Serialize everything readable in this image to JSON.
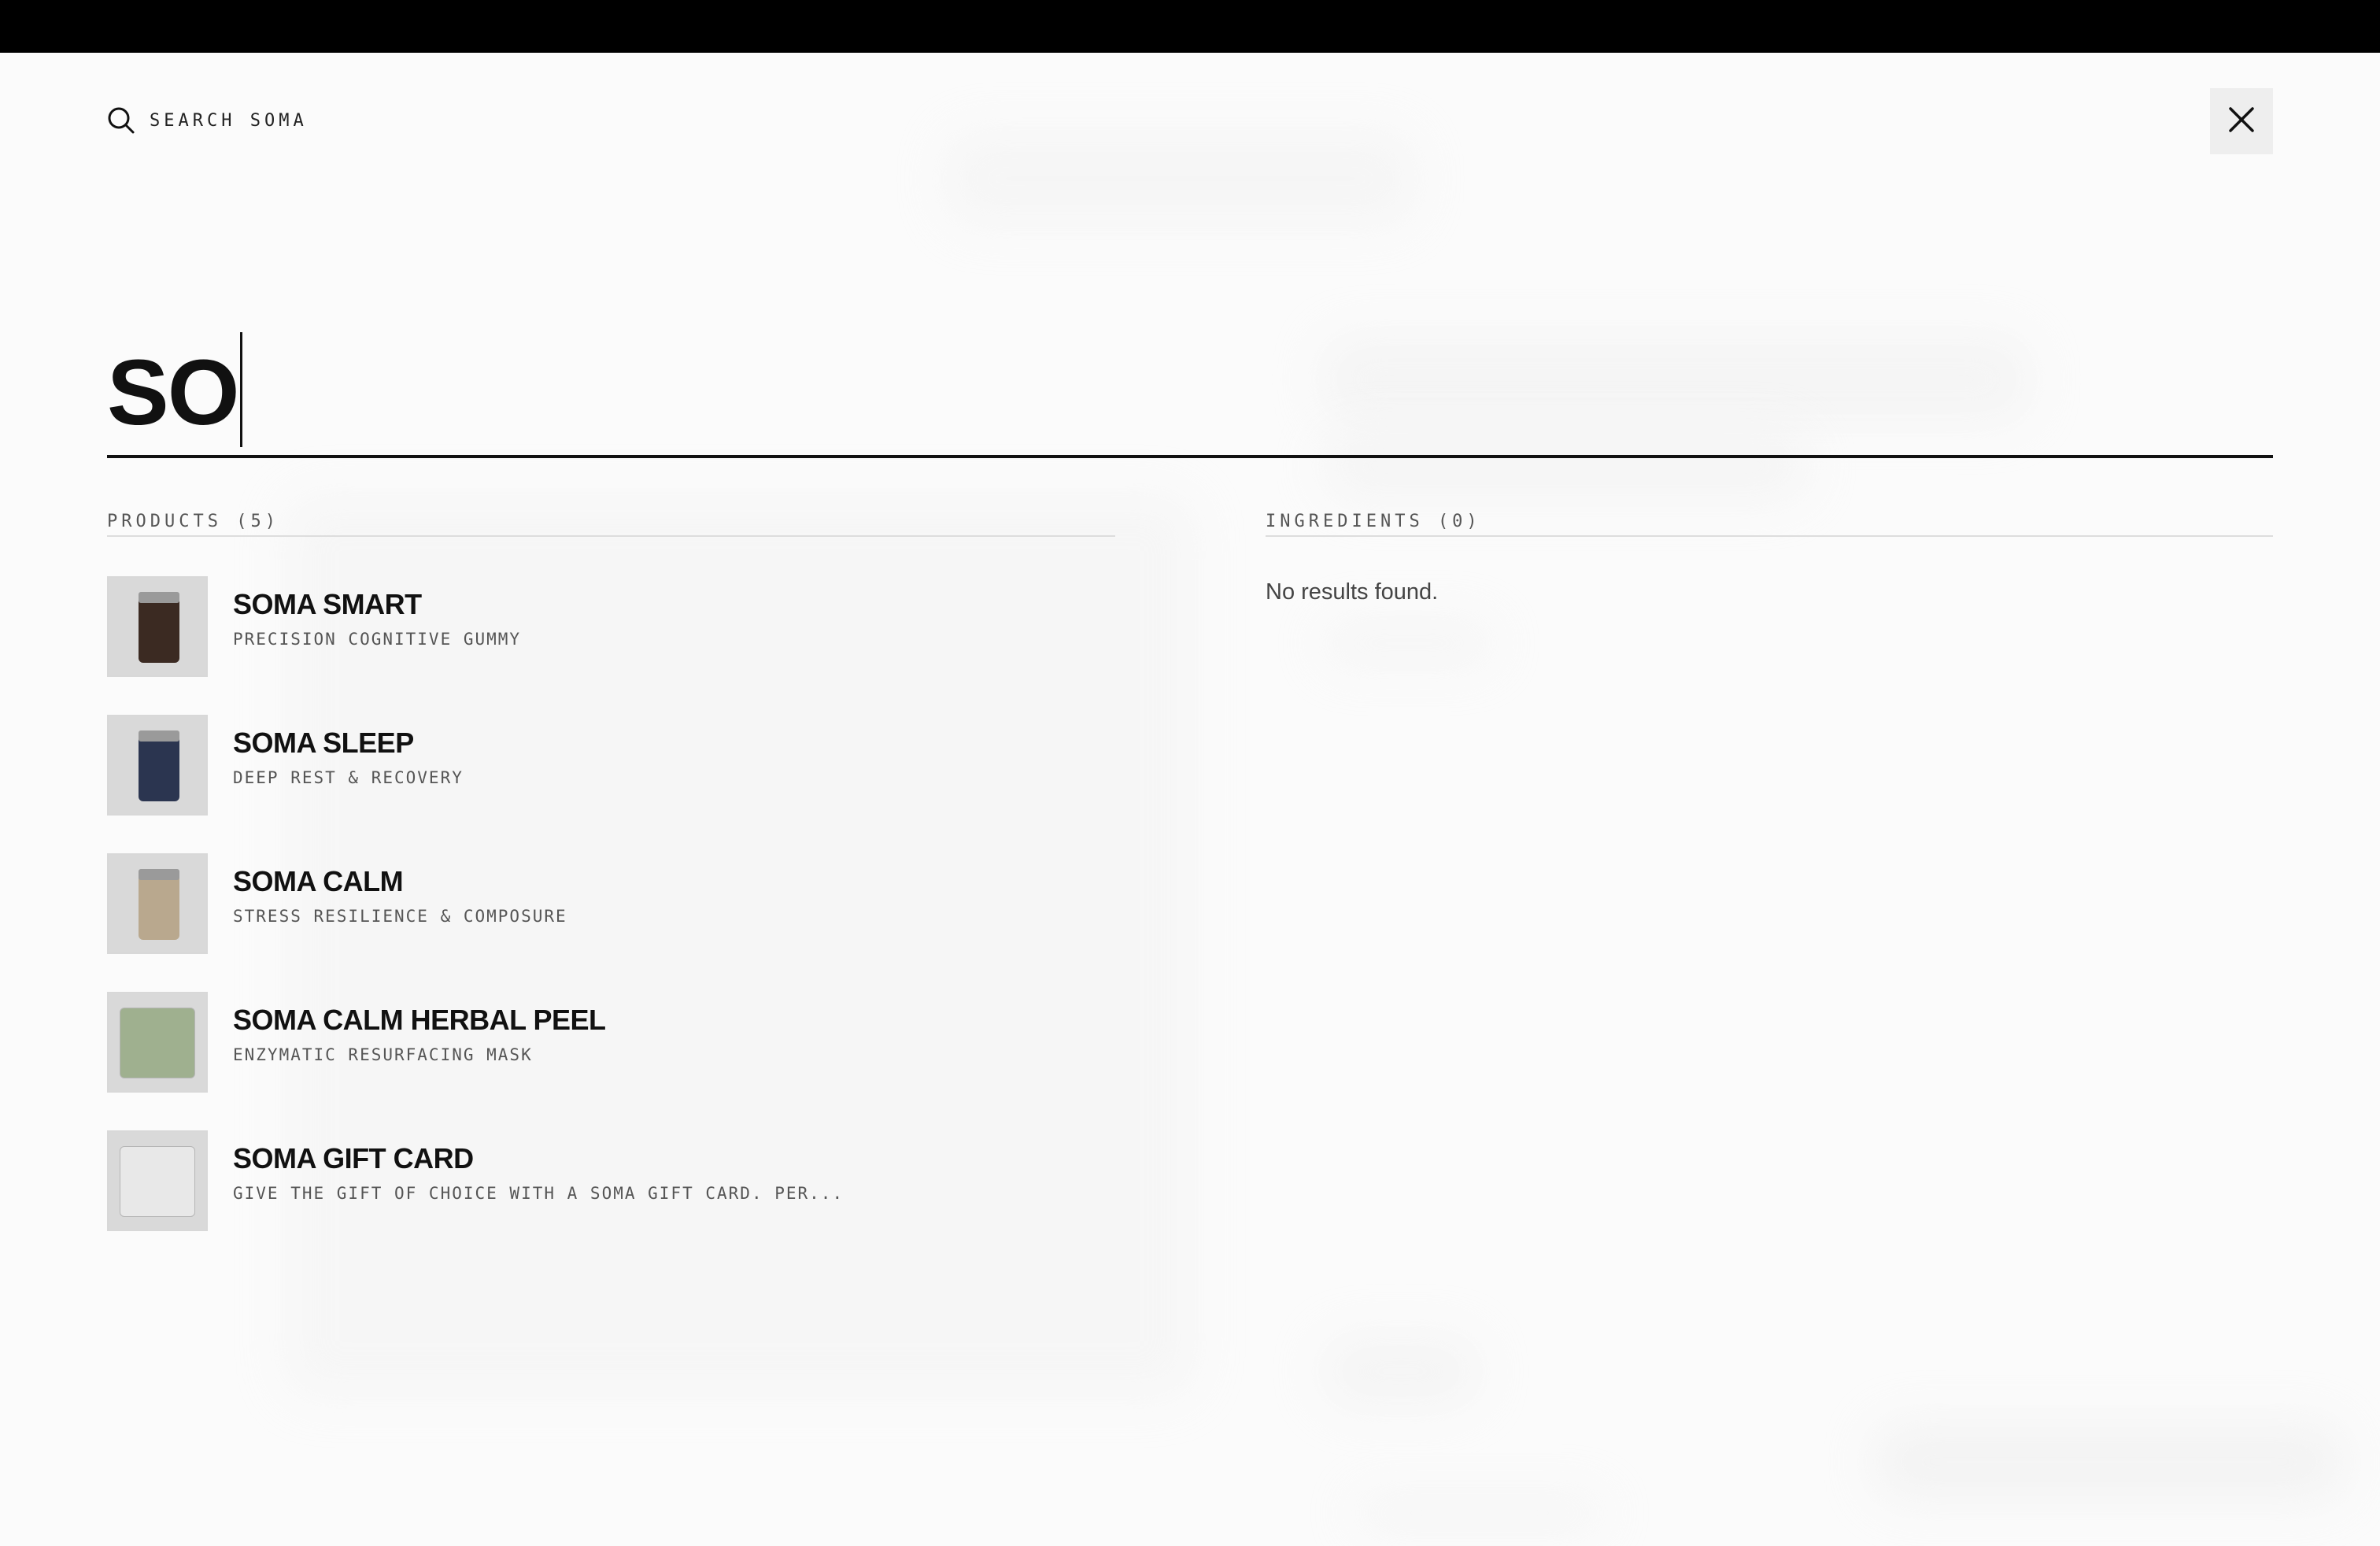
{
  "header": {
    "search_label": "SEARCH SOMA",
    "close_label": "Close search"
  },
  "search": {
    "query": "SO"
  },
  "products": {
    "heading": "PRODUCTS (5)",
    "items": [
      {
        "name": "SOMA SMART",
        "description": "PRECISION COGNITIVE GUMMY",
        "thumb_color": "#3b2a22"
      },
      {
        "name": "SOMA SLEEP",
        "description": "DEEP REST & RECOVERY",
        "thumb_color": "#2b3550"
      },
      {
        "name": "SOMA CALM",
        "description": "STRESS RESILIENCE & COMPOSURE",
        "thumb_color": "#b9a88e"
      },
      {
        "name": "SOMA CALM HERBAL PEEL",
        "description": "ENZYMATIC RESURFACING MASK",
        "thumb_color": "#9fb08f"
      },
      {
        "name": "SOMA GIFT CARD",
        "description": "GIVE THE GIFT OF CHOICE WITH A SOMA GIFT CARD. PER...",
        "thumb_color": "#e8e8e8"
      }
    ]
  },
  "ingredients": {
    "heading": "INGREDIENTS (0)",
    "empty_message": "No results found."
  }
}
